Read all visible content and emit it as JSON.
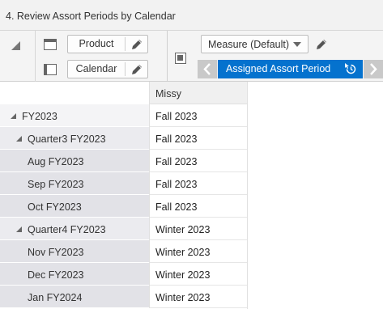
{
  "window": {
    "title": "4. Review Assort Periods by Calendar"
  },
  "dimensions": {
    "product_label": "Product",
    "calendar_label": "Calendar"
  },
  "measure": {
    "selected": "Measure (Default)",
    "current": "Assigned Assort Period"
  },
  "grid": {
    "column_header": "Missy",
    "rows": [
      {
        "label": "FY2023",
        "value": "Fall 2023",
        "level": 0,
        "expandable": true
      },
      {
        "label": "Quarter3 FY2023",
        "value": "Fall 2023",
        "level": 1,
        "expandable": true
      },
      {
        "label": "Aug FY2023",
        "value": "Fall 2023",
        "level": 2,
        "expandable": false
      },
      {
        "label": "Sep FY2023",
        "value": "Fall 2023",
        "level": 2,
        "expandable": false
      },
      {
        "label": "Oct FY2023",
        "value": "Fall 2023",
        "level": 2,
        "expandable": false
      },
      {
        "label": "Quarter4 FY2023",
        "value": "Winter 2023",
        "level": 1,
        "expandable": true
      },
      {
        "label": "Nov FY2023",
        "value": "Winter 2023",
        "level": 2,
        "expandable": false
      },
      {
        "label": "Dec FY2023",
        "value": "Winter 2023",
        "level": 2,
        "expandable": false
      },
      {
        "label": "Jan FY2024",
        "value": "Winter 2023",
        "level": 2,
        "expandable": false
      }
    ]
  },
  "colors": {
    "accent": "#0572ce",
    "toolbar_bg": "#f4f4f4"
  }
}
